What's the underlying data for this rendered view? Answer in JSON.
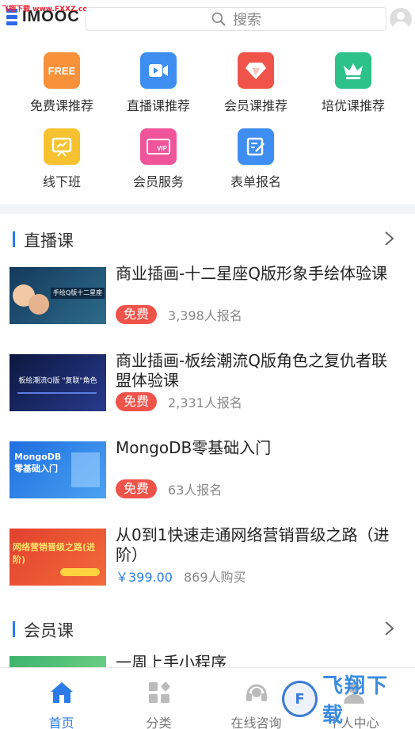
{
  "watermark_top": "飞翔下载 www.FXXZ.com",
  "header": {
    "logo": "IMOOC",
    "search_placeholder": "搜索"
  },
  "categories": [
    {
      "label": "免费课推荐",
      "icon": "free-icon",
      "color": "#f7913a",
      "glyph": "FREE"
    },
    {
      "label": "直播课推荐",
      "icon": "video-camera-icon",
      "color": "#3d8ef0"
    },
    {
      "label": "会员课推荐",
      "icon": "diamond-icon",
      "color": "#f0534a"
    },
    {
      "label": "培优课推荐",
      "icon": "crown-icon",
      "color": "#2cc28a"
    },
    {
      "label": "线下班",
      "icon": "whiteboard-icon",
      "color": "#f7c22f"
    },
    {
      "label": "会员服务",
      "icon": "vip-card-icon",
      "color": "#f0549a",
      "glyph": "VIP"
    },
    {
      "label": "表单报名",
      "icon": "form-icon",
      "color": "#3d8ef0"
    }
  ],
  "sections": {
    "live": {
      "title": "直播课"
    },
    "member": {
      "title": "会员课"
    }
  },
  "courses": [
    {
      "title": "商业插画-十二星座Q版形象手绘体验课",
      "badge": "免费",
      "count": "3,398人报名",
      "thumb_text": "手绘Q版十二星座"
    },
    {
      "title": "商业插画-板绘潮流Q版角色之复仇者联盟体验课",
      "badge": "免费",
      "count": "2,331人报名",
      "thumb_text": "板绘潮流Q版 \"复联\"角色"
    },
    {
      "title": "MongoDB零基础入门",
      "badge": "免费",
      "count": "63人报名",
      "thumb_text": "MongoDB 零基础入门"
    },
    {
      "title": "从0到1快速走通网络营销晋级之路（进阶）",
      "price": "￥399.00",
      "count": "869人购买",
      "thumb_text": "网络营销晋级之路(进阶)"
    }
  ],
  "member_course": {
    "title": "一周上手小程序"
  },
  "nav": [
    {
      "label": "首页",
      "icon": "home-icon",
      "active": true
    },
    {
      "label": "分类",
      "icon": "grid-icon"
    },
    {
      "label": "在线咨询",
      "icon": "headset-icon"
    },
    {
      "label": "个人中心",
      "icon": "user-icon"
    }
  ],
  "watermark_bottom": "飞翔下载",
  "colors": {
    "accent": "#2b7be8",
    "badge": "#f0534a"
  }
}
